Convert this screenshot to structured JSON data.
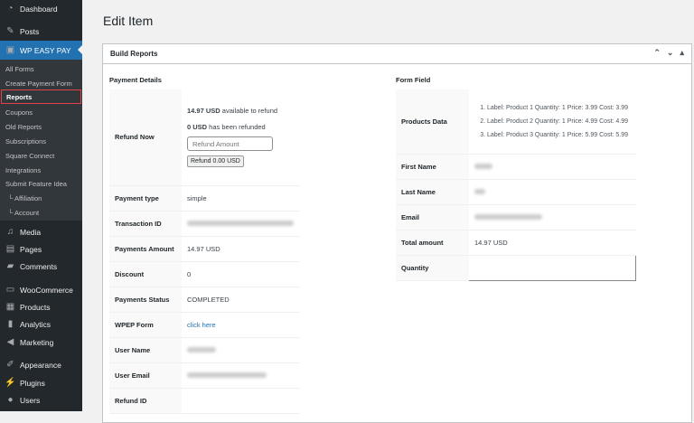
{
  "sidebar": {
    "top": [
      {
        "label": "Dashboard",
        "icon": "dashboard-icon"
      },
      {
        "label": "Posts",
        "icon": "pin-icon"
      },
      {
        "label": "WP EASY PAY",
        "icon": "plugin-icon"
      }
    ],
    "submenu": [
      "All Forms",
      "Create Payment Form",
      "Reports",
      "Coupons",
      "Old Reports",
      "Subscriptions",
      "Square Connect",
      "Integrations",
      "Submit Feature Idea",
      "└ Affiliation",
      "└ Account"
    ],
    "bottom": [
      {
        "label": "Media"
      },
      {
        "label": "Pages"
      },
      {
        "label": "Comments"
      },
      {
        "label": "WooCommerce"
      },
      {
        "label": "Products"
      },
      {
        "label": "Analytics"
      },
      {
        "label": "Marketing"
      },
      {
        "label": "Appearance"
      },
      {
        "label": "Plugins"
      },
      {
        "label": "Users"
      }
    ]
  },
  "page": {
    "title": "Edit Item",
    "box_title": "Build Reports"
  },
  "payment": {
    "heading": "Payment Details",
    "refund_label": "Refund Now",
    "available_amount": "14.97 USD",
    "available_text": " available to refund",
    "refunded_amount": "0 USD",
    "refunded_text": " has been refunded",
    "refund_placeholder": "Refund Amount",
    "refund_button": "Refund 0.00 USD",
    "rows": [
      {
        "label": "Payment type",
        "value": "simple"
      },
      {
        "label": "Transaction ID",
        "value": ""
      },
      {
        "label": "Payments Amount",
        "value": "14.97 USD"
      },
      {
        "label": "Discount",
        "value": "0"
      },
      {
        "label": "Payments Status",
        "value": "COMPLETED"
      },
      {
        "label": "WPEP Form",
        "value": "click here"
      },
      {
        "label": "User Name",
        "value": ""
      },
      {
        "label": "User Email",
        "value": ""
      },
      {
        "label": "Refund ID",
        "value": ""
      }
    ]
  },
  "form": {
    "heading": "Form Field",
    "products_label": "Products Data",
    "products": [
      "Label: Product 1 Quantity: 1 Price: 3.99 Cost: 3.99",
      "Label: Product 2 Quantity: 1 Price: 4.99 Cost: 4.99",
      "Label: Product 3 Quantity: 1 Price: 5.99 Cost: 5.99"
    ],
    "rows": [
      {
        "label": "First Name",
        "value": ""
      },
      {
        "label": "Last Name",
        "value": ""
      },
      {
        "label": "Email",
        "value": ""
      },
      {
        "label": "Total amount",
        "value": "14.97 USD"
      },
      {
        "label": "Quantity",
        "value": ""
      }
    ]
  }
}
